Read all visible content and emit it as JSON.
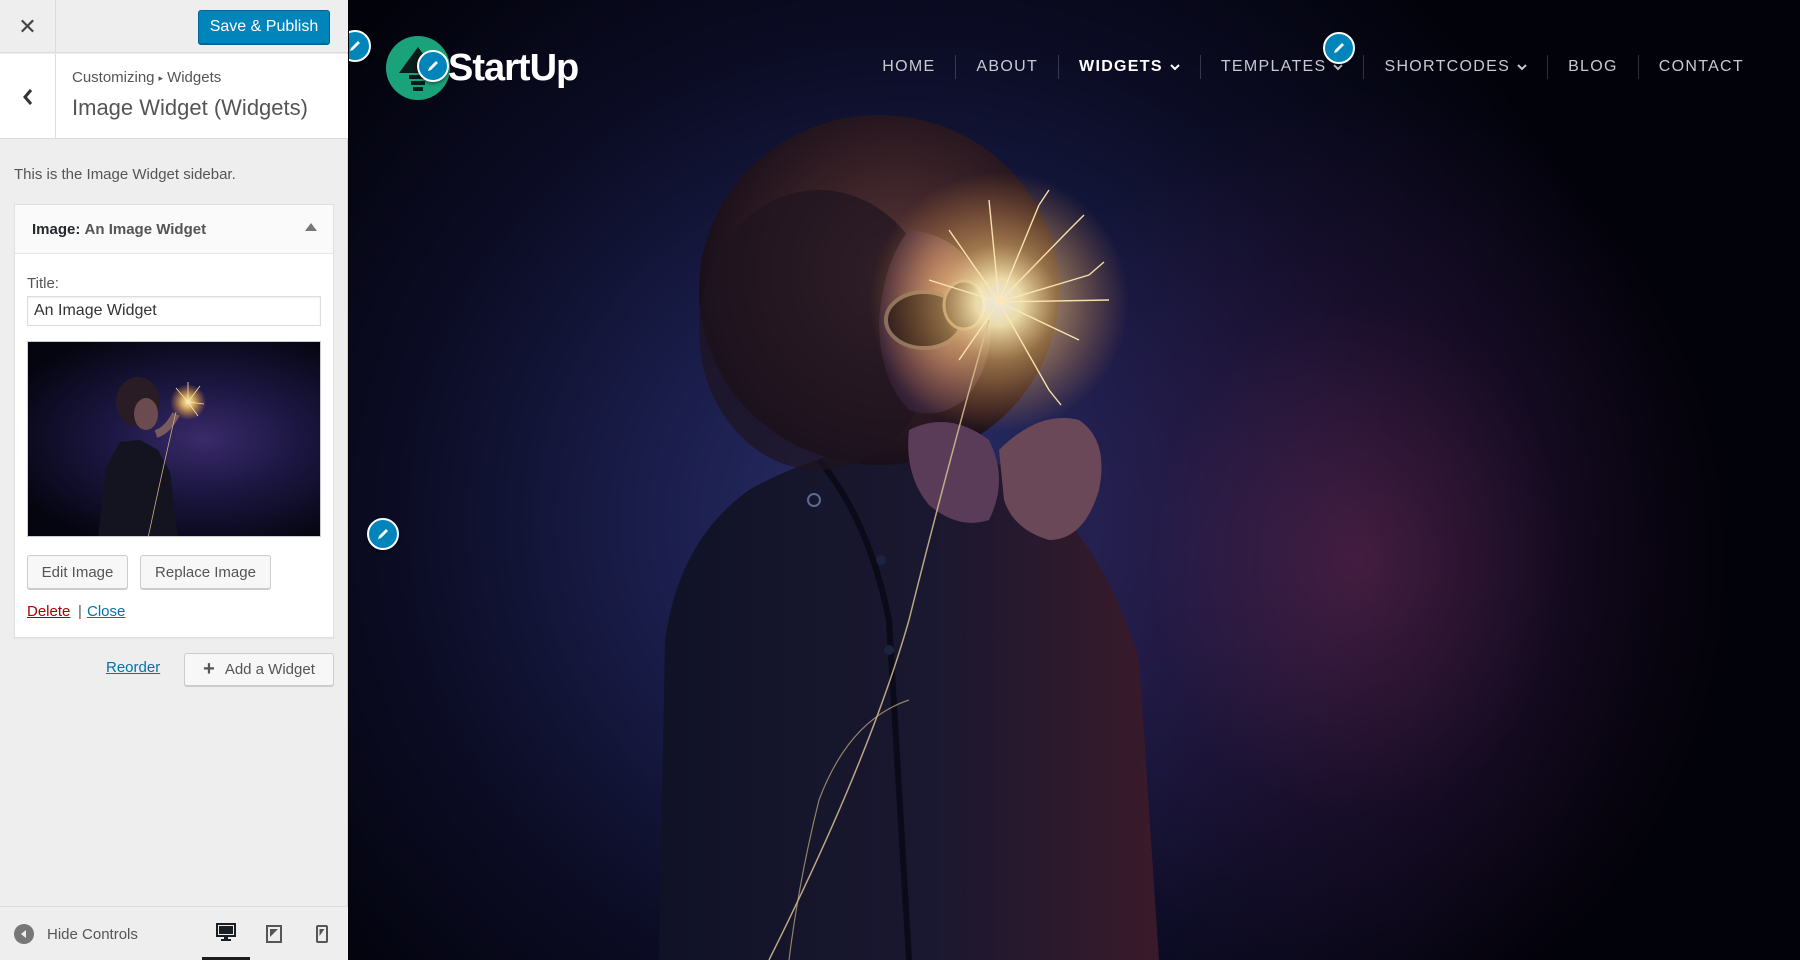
{
  "customizer": {
    "close_icon": "close-icon",
    "save_label": "Save & Publish",
    "breadcrumb": {
      "parent": "Customizing",
      "separator": "▸",
      "current": "Widgets"
    },
    "section_title": "Image Widget (Widgets)",
    "sidebar_description": "This is the Image Widget sidebar."
  },
  "widget": {
    "type_label": "Image:",
    "name": "An Image Widget",
    "title_label": "Title:",
    "title_value": "An Image Widget",
    "edit_image_label": "Edit Image",
    "replace_image_label": "Replace Image",
    "delete_label": "Delete",
    "link_separator": "|",
    "close_label": "Close"
  },
  "sidebar_actions": {
    "reorder_label": "Reorder",
    "add_widget_label": "Add a Widget"
  },
  "footer": {
    "hide_controls_label": "Hide Controls",
    "devices": [
      "desktop",
      "tablet",
      "mobile"
    ],
    "active_device": "desktop"
  },
  "preview": {
    "logo_text": "StartUp",
    "nav": [
      {
        "label": "HOME",
        "dropdown": false,
        "active": false
      },
      {
        "label": "ABOUT",
        "dropdown": false,
        "active": false
      },
      {
        "label": "WIDGETS",
        "dropdown": true,
        "active": true
      },
      {
        "label": "TEMPLATES",
        "dropdown": true,
        "active": false
      },
      {
        "label": "SHORTCODES",
        "dropdown": true,
        "active": false
      },
      {
        "label": "BLOG",
        "dropdown": false,
        "active": false
      },
      {
        "label": "CONTACT",
        "dropdown": false,
        "active": false
      }
    ]
  },
  "colors": {
    "primary_button": "#0085ba",
    "link": "#0073aa",
    "delete": "#aa0000",
    "logo_green": "#1aa37a",
    "shortcut_blue": "#0085ba"
  }
}
